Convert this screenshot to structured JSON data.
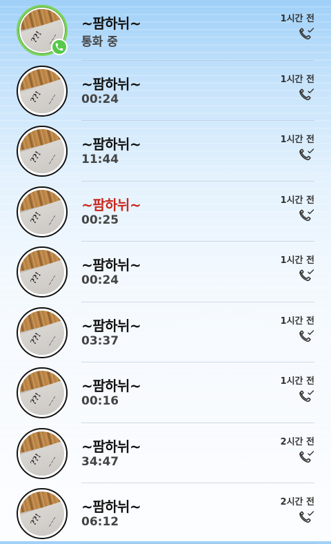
{
  "calls": [
    {
      "name": "~팜하뉘~",
      "detail": "통화 중",
      "time": "1시간 전",
      "missed": false,
      "active": true
    },
    {
      "name": "~팜하뉘~",
      "detail": "00:24",
      "time": "1시간 전",
      "missed": false,
      "active": false
    },
    {
      "name": "~팜하뉘~",
      "detail": "11:44",
      "time": "1시간 전",
      "missed": false,
      "active": false
    },
    {
      "name": "~팜하뉘~",
      "detail": "00:25",
      "time": "1시간 전",
      "missed": true,
      "active": false
    },
    {
      "name": "~팜하뉘~",
      "detail": "00:24",
      "time": "1시간 전",
      "missed": false,
      "active": false
    },
    {
      "name": "~팜하뉘~",
      "detail": "03:37",
      "time": "1시간 전",
      "missed": false,
      "active": false
    },
    {
      "name": "~팜하뉘~",
      "detail": "00:16",
      "time": "1시간 전",
      "missed": false,
      "active": false
    },
    {
      "name": "~팜하뉘~",
      "detail": "34:47",
      "time": "2시간 전",
      "missed": false,
      "active": false
    },
    {
      "name": "~팜하뉘~",
      "detail": "06:12",
      "time": "2시간 전",
      "missed": false,
      "active": false
    }
  ],
  "colors": {
    "missed": "#c8281e",
    "active_ring": "#7bd35a",
    "call_badge": "#57c84a"
  },
  "icons": {
    "status": "phone-check-icon",
    "badge": "phone-icon"
  }
}
